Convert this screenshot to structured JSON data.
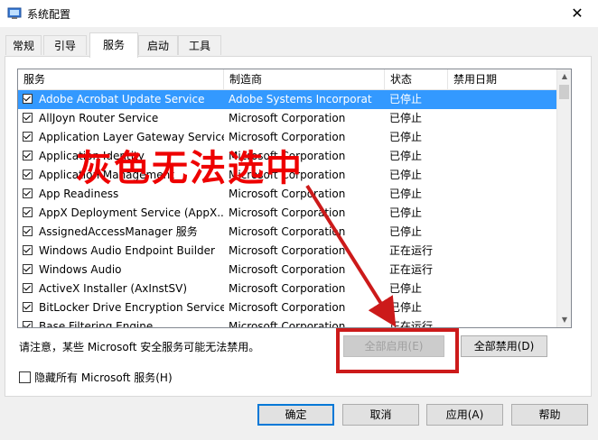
{
  "window": {
    "title": "系统配置",
    "close_glyph": "✕"
  },
  "tabs": [
    {
      "label": "常规"
    },
    {
      "label": "引导"
    },
    {
      "label": "服务",
      "active": true
    },
    {
      "label": "启动"
    },
    {
      "label": "工具"
    }
  ],
  "columns": [
    "服务",
    "制造商",
    "状态",
    "禁用日期"
  ],
  "services": [
    {
      "name": "Adobe Acrobat Update Service",
      "vendor": "Adobe Systems Incorporat",
      "status": "已停止",
      "checked": true,
      "selected": true
    },
    {
      "name": "AllJoyn Router Service",
      "vendor": "Microsoft Corporation",
      "status": "已停止",
      "checked": true
    },
    {
      "name": "Application Layer Gateway Service",
      "vendor": "Microsoft Corporation",
      "status": "已停止",
      "checked": true
    },
    {
      "name": "Application Identity",
      "vendor": "Microsoft Corporation",
      "status": "已停止",
      "checked": true
    },
    {
      "name": "Application Management",
      "vendor": "Microsoft Corporation",
      "status": "已停止",
      "checked": true
    },
    {
      "name": "App Readiness",
      "vendor": "Microsoft Corporation",
      "status": "已停止",
      "checked": true
    },
    {
      "name": "AppX Deployment Service (AppX...",
      "vendor": "Microsoft Corporation",
      "status": "已停止",
      "checked": true
    },
    {
      "name": "AssignedAccessManager 服务",
      "vendor": "Microsoft Corporation",
      "status": "已停止",
      "checked": true
    },
    {
      "name": "Windows Audio Endpoint Builder",
      "vendor": "Microsoft Corporation",
      "status": "正在运行",
      "checked": true
    },
    {
      "name": "Windows Audio",
      "vendor": "Microsoft Corporation",
      "status": "正在运行",
      "checked": true
    },
    {
      "name": "ActiveX Installer (AxInstSV)",
      "vendor": "Microsoft Corporation",
      "status": "已停止",
      "checked": true
    },
    {
      "name": "BitLocker Drive Encryption Service",
      "vendor": "Microsoft Corporation",
      "status": "已停止",
      "checked": true
    },
    {
      "name": "Base Filtering Engine",
      "vendor": "Microsoft Corporation",
      "status": "正在运行",
      "checked": true
    }
  ],
  "notice": "请注意，某些 Microsoft 安全服务可能无法禁用。",
  "enable_all_label": "全部启用(E)",
  "disable_all_label": "全部禁用(D)",
  "hide_ms_label": "隐藏所有 Microsoft 服务(H)",
  "buttons": {
    "ok": "确定",
    "cancel": "取消",
    "apply": "应用(A)",
    "help": "帮助"
  },
  "annotation": {
    "text": "灰色无法选中",
    "color": "#ee0000"
  },
  "colors": {
    "selection": "#3399ff",
    "annotation_box": "#cc1a1a"
  }
}
